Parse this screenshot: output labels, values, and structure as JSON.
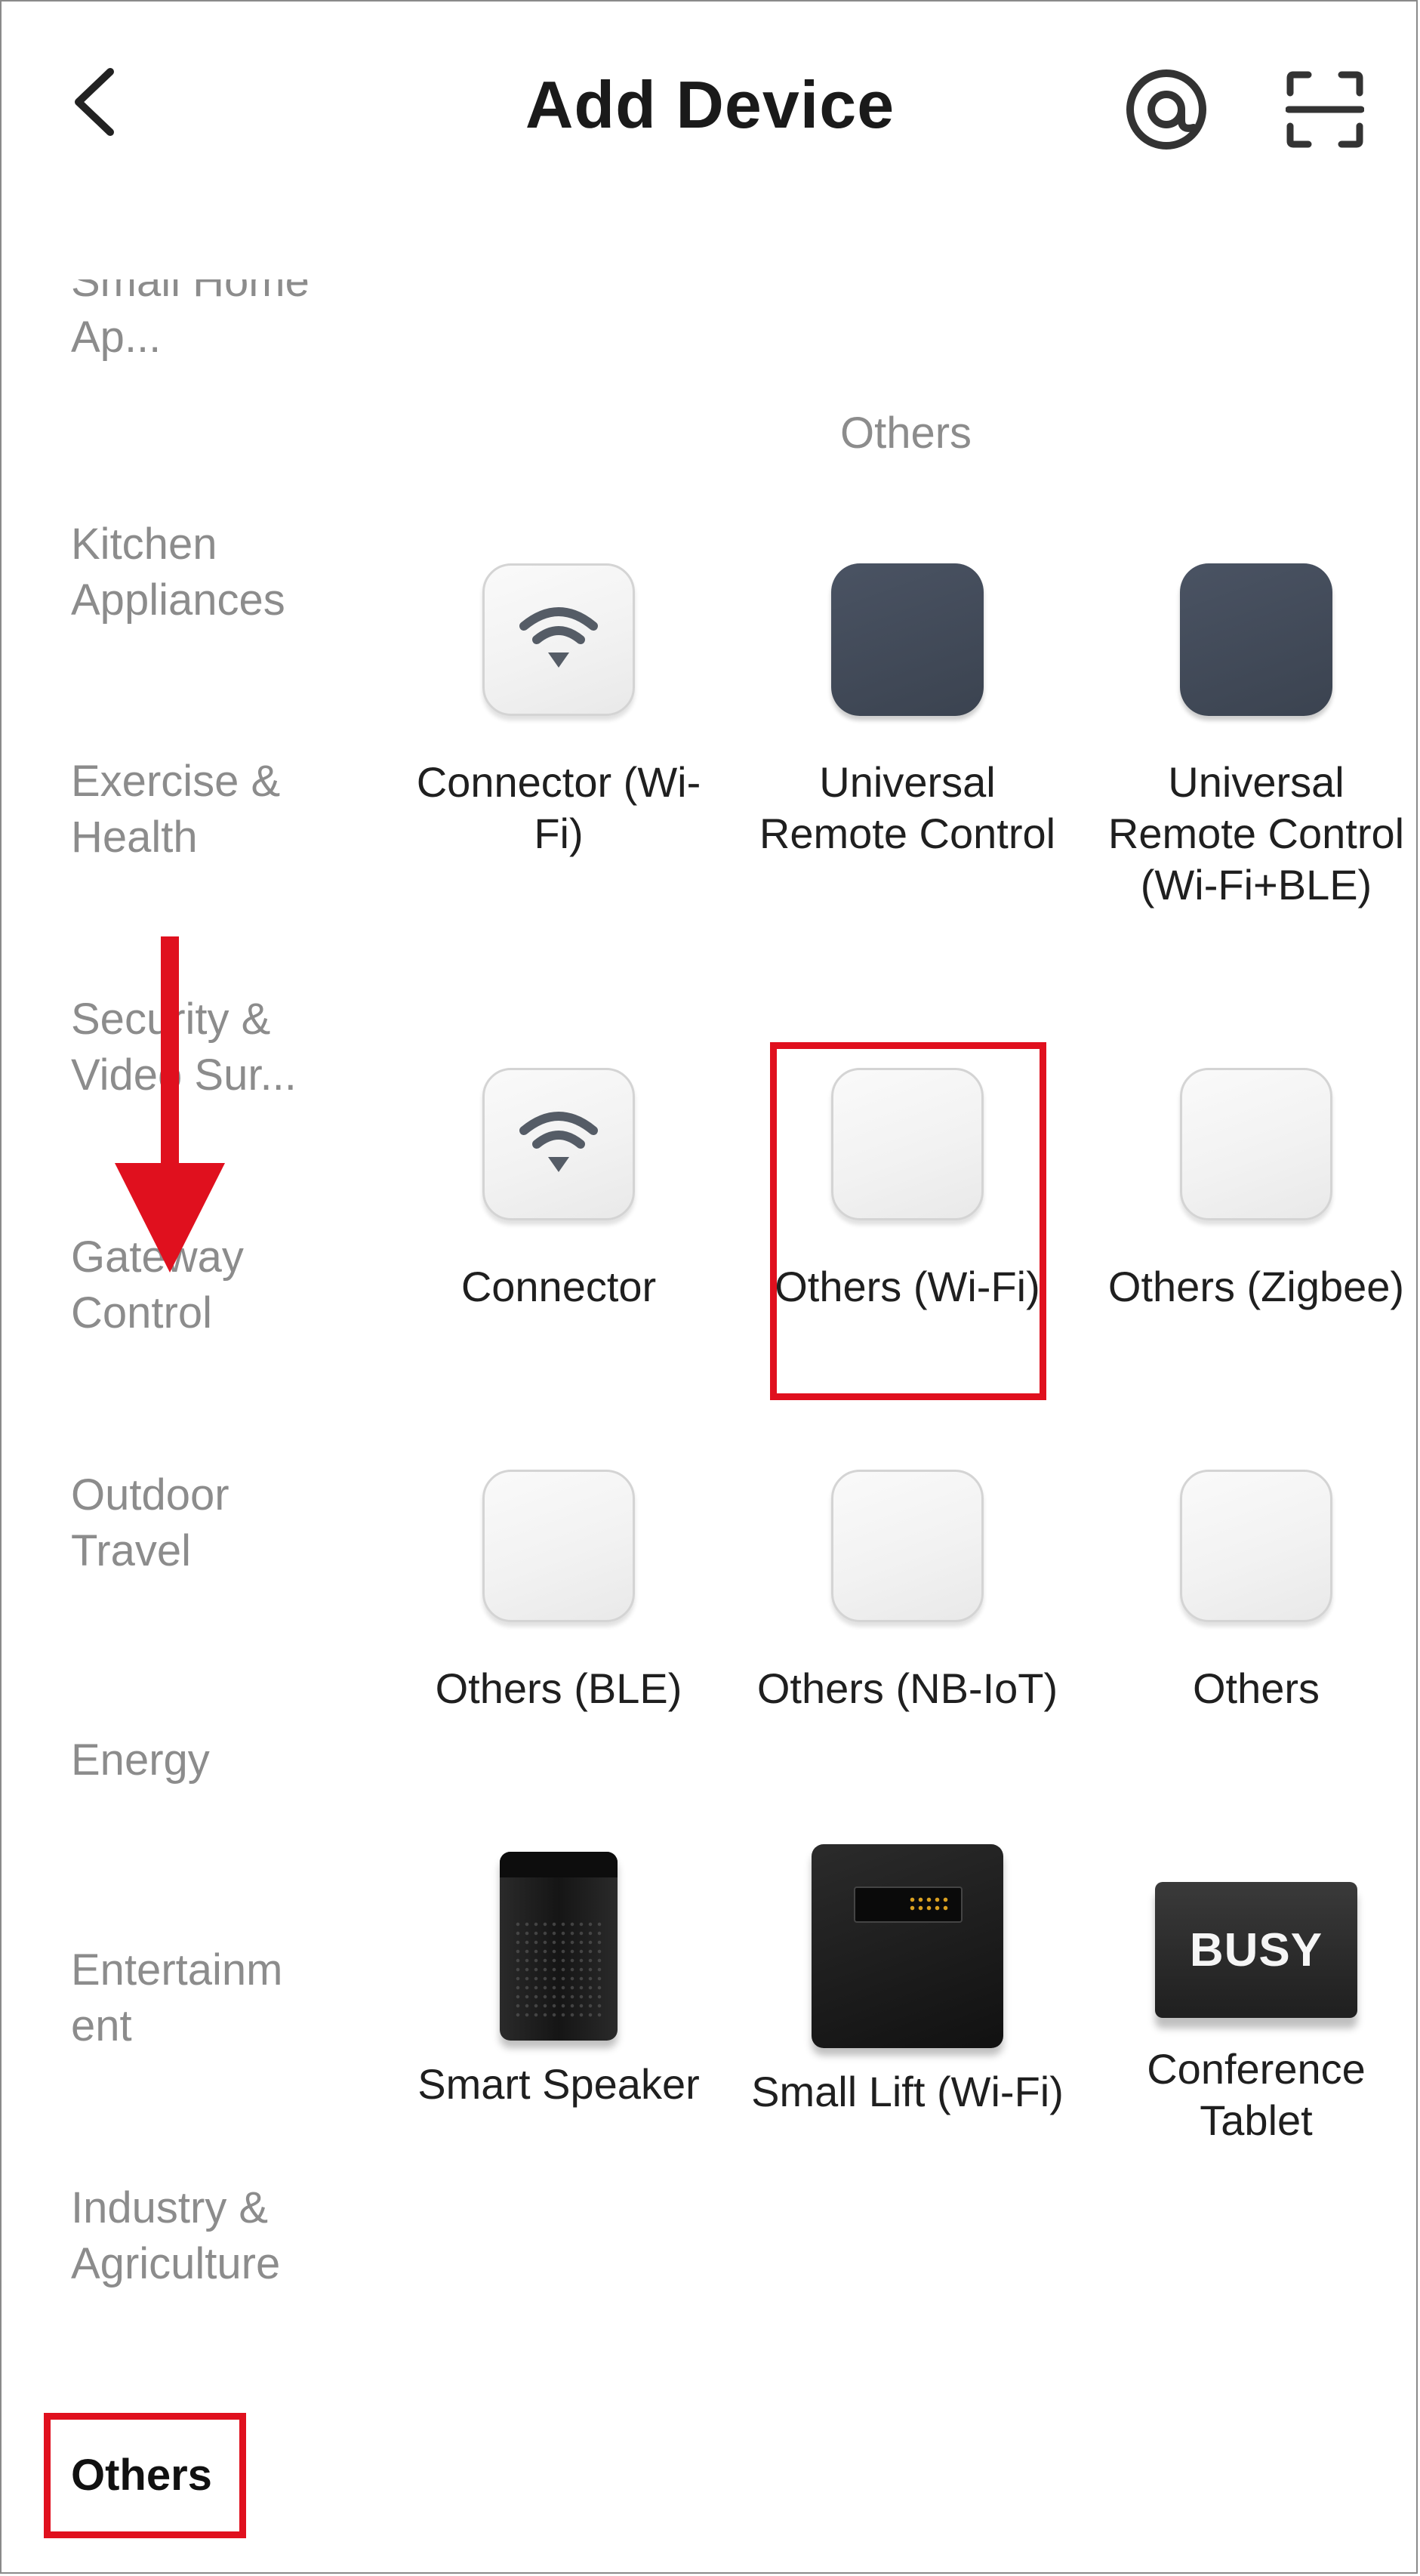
{
  "header": {
    "title": "Add Device",
    "back_icon": "chevron-left-icon",
    "at_icon": "at-sign-icon",
    "scan_icon": "scan-icon"
  },
  "sidebar": {
    "items": [
      {
        "label": "Small Home Ap..."
      },
      {
        "label": "Kitchen Appliances"
      },
      {
        "label": "Exercise & Health"
      },
      {
        "label": "Security & Video Sur..."
      },
      {
        "label": "Gateway Control"
      },
      {
        "label": "Outdoor Travel"
      },
      {
        "label": "Energy"
      },
      {
        "label": "Entertainm ent"
      },
      {
        "label": "Industry & Agriculture"
      },
      {
        "label": "Others",
        "selected": true
      }
    ]
  },
  "main": {
    "section_title": "Others",
    "devices": [
      {
        "label": "Connector (Wi-Fi)",
        "icon": "wifi-tile-icon"
      },
      {
        "label": "Universal Remote Control",
        "icon": "dark-tile-icon"
      },
      {
        "label": "Universal Remote Control (Wi-Fi+BLE)",
        "icon": "dark-tile-icon"
      },
      {
        "label": "Connector",
        "icon": "wifi-tile-icon"
      },
      {
        "label": "Others (Wi-Fi)",
        "icon": "blank-tile-icon",
        "highlighted": true
      },
      {
        "label": "Others (Zigbee)",
        "icon": "blank-tile-icon"
      },
      {
        "label": "Others (BLE)",
        "icon": "blank-tile-icon"
      },
      {
        "label": "Others (NB-IoT)",
        "icon": "blank-tile-icon"
      },
      {
        "label": "Others",
        "icon": "blank-tile-icon"
      },
      {
        "label": "Smart Speaker",
        "icon": "speaker-icon"
      },
      {
        "label": "Small Lift (Wi-Fi)",
        "icon": "safe-icon"
      },
      {
        "label": "Conference Tablet",
        "icon": "busy-tablet-icon",
        "tablet_text": "BUSY"
      }
    ]
  },
  "colors": {
    "highlight": "#e0101e",
    "inactive_text": "#8c8c8c",
    "active_text": "#111111"
  }
}
